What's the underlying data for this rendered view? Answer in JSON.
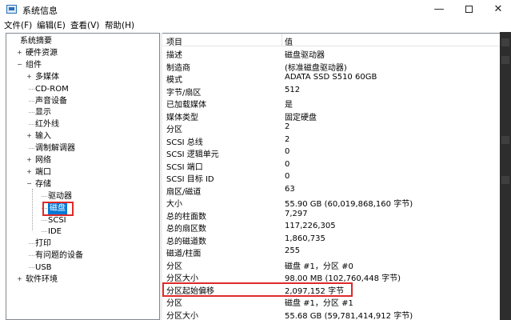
{
  "window": {
    "title": "系统信息"
  },
  "window_controls": {
    "minimize": "—",
    "close": "✕"
  },
  "menu": [
    "文件(F)",
    "编辑(E)",
    "查看(V)",
    "帮助(H)"
  ],
  "tree": [
    {
      "label": "系统摘要",
      "depth": 0,
      "expander": ""
    },
    {
      "label": "硬件资源",
      "depth": 1,
      "expander": "+"
    },
    {
      "label": "组件",
      "depth": 1,
      "expander": "−"
    },
    {
      "label": "多媒体",
      "depth": 2,
      "expander": "+"
    },
    {
      "label": "CD-ROM",
      "depth": 2,
      "expander": ""
    },
    {
      "label": "声音设备",
      "depth": 2,
      "expander": ""
    },
    {
      "label": "显示",
      "depth": 2,
      "expander": ""
    },
    {
      "label": "红外线",
      "depth": 2,
      "expander": ""
    },
    {
      "label": "输入",
      "depth": 2,
      "expander": "+"
    },
    {
      "label": "调制解调器",
      "depth": 2,
      "expander": ""
    },
    {
      "label": "网络",
      "depth": 2,
      "expander": "+"
    },
    {
      "label": "端口",
      "depth": 2,
      "expander": "+"
    },
    {
      "label": "存储",
      "depth": 2,
      "expander": "−"
    },
    {
      "label": "驱动器",
      "depth": 3,
      "expander": ""
    },
    {
      "label": "磁盘",
      "depth": 3,
      "expander": "",
      "selected": true
    },
    {
      "label": "SCSI",
      "depth": 3,
      "expander": ""
    },
    {
      "label": "IDE",
      "depth": 3,
      "expander": ""
    },
    {
      "label": "打印",
      "depth": 2,
      "expander": ""
    },
    {
      "label": "有问题的设备",
      "depth": 2,
      "expander": ""
    },
    {
      "label": "USB",
      "depth": 2,
      "expander": ""
    },
    {
      "label": "软件环境",
      "depth": 1,
      "expander": "+"
    }
  ],
  "list": {
    "headers": [
      "项目",
      "值"
    ],
    "rows": [
      [
        "描述",
        "磁盘驱动器"
      ],
      [
        "制造商",
        "(标准磁盘驱动器)"
      ],
      [
        "模式",
        "ADATA SSD S510 60GB"
      ],
      [
        "字节/扇区",
        "512"
      ],
      [
        "已加载媒体",
        "是"
      ],
      [
        "媒体类型",
        "固定硬盘"
      ],
      [
        "分区",
        "2"
      ],
      [
        "SCSI 总线",
        "2"
      ],
      [
        "SCSI 逻辑单元",
        "0"
      ],
      [
        "SCSI 端口",
        "0"
      ],
      [
        "SCSI 目标 ID",
        "0"
      ],
      [
        "扇区/磁道",
        "63"
      ],
      [
        "大小",
        "55.90 GB (60,019,868,160 字节)"
      ],
      [
        "总的柱面数",
        "7,297"
      ],
      [
        "总的扇区数",
        "117,226,305"
      ],
      [
        "总的磁道数",
        "1,860,735"
      ],
      [
        "磁道/柱面",
        "255"
      ],
      [
        "分区",
        "磁盘 #1，分区 #0"
      ],
      [
        "分区大小",
        "98.00 MB (102,760,448 字节)"
      ],
      [
        "分区起始偏移",
        "2,097,152 字节",
        true
      ],
      [
        "分区",
        "磁盘 #1，分区 #1"
      ],
      [
        "分区大小",
        "55.68 GB (59,781,414,912 字节)"
      ]
    ]
  },
  "colors": {
    "selection": "#0078d7",
    "highlight_box": "#e02a2a",
    "border": "#828790"
  }
}
